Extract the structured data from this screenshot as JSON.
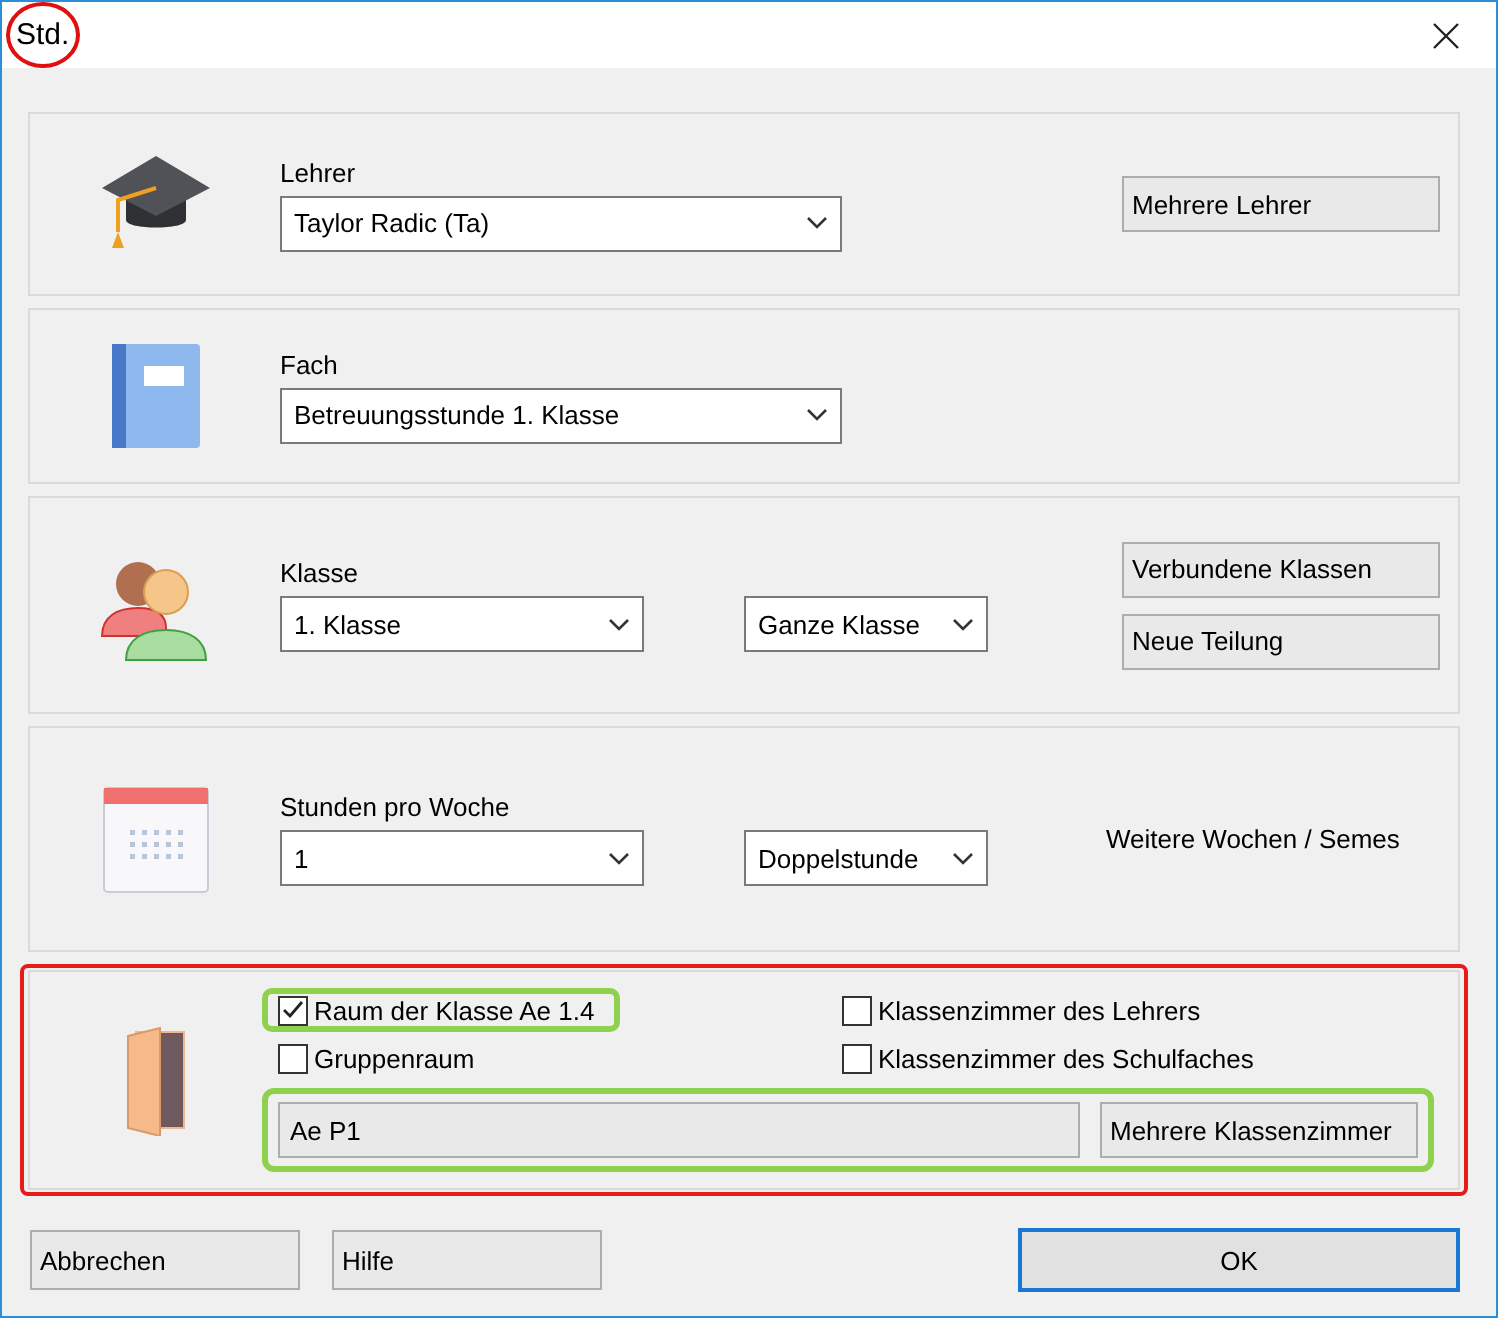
{
  "window": {
    "title": "Std.",
    "title_circled": true
  },
  "sections": [
    {
      "kind": "teacher",
      "label": "Lehrer",
      "select": "Taylor Radic (Ta)",
      "buttons": [
        "Mehrere Lehrer"
      ]
    },
    {
      "kind": "subject",
      "label": "Fach",
      "select": "Betreuungsstunde 1. Klasse"
    },
    {
      "kind": "class",
      "label": "Klasse",
      "select": "1. Klasse",
      "select_2": "Ganze Klasse",
      "buttons": [
        "Verbundene Klassen",
        "Neue Teilung"
      ]
    },
    {
      "kind": "hours",
      "label": "Stunden pro Woche",
      "select": "1",
      "select_2": "Doppelstunde",
      "link": "Weitere Wochen / Semes"
    }
  ],
  "room": {
    "highlighted": true,
    "checkboxes": [
      {
        "label": "Raum der Klasse Ae 1.4",
        "checked": true,
        "highlighted": true
      },
      {
        "label": "Gruppenraum",
        "checked": false,
        "highlighted": false
      },
      {
        "label": "Klassenzimmer des Lehrers",
        "checked": false,
        "highlighted": false
      },
      {
        "label": "Klassenzimmer des Schulfaches",
        "checked": false,
        "highlighted": false
      }
    ],
    "field": "Ae P1",
    "button": "Mehrere Klassenzimmer",
    "field_highlighted": true
  },
  "buttons": [
    {
      "label": "Abbrechen",
      "default": false
    },
    {
      "label": "Hilfe",
      "default": false
    },
    {
      "label": "OK",
      "default": true
    }
  ]
}
